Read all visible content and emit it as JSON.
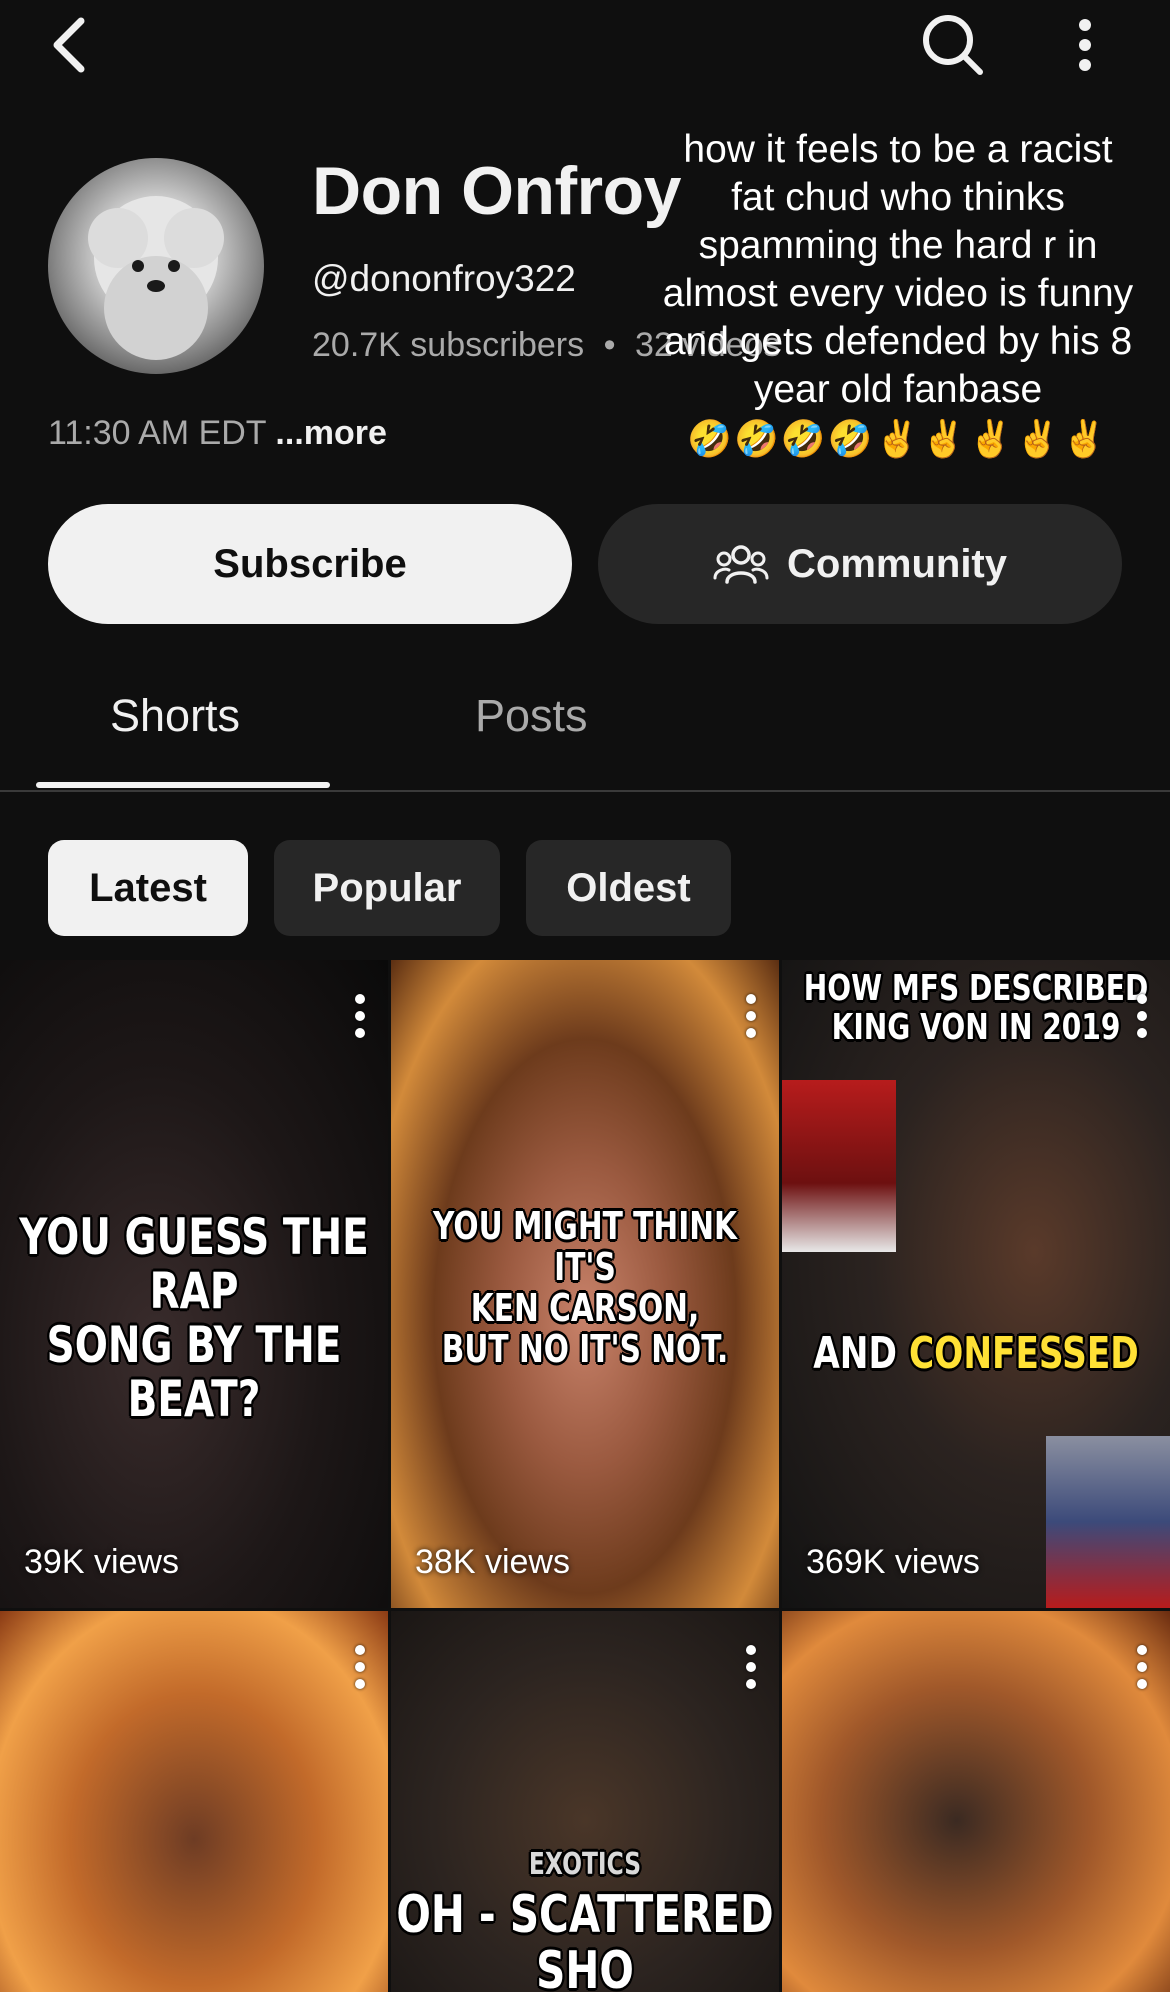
{
  "topbar": {
    "back_icon": "chevron-left-icon",
    "search_icon": "search-icon",
    "more_icon": "more-vertical-icon"
  },
  "channel": {
    "name": "Don Onfroy",
    "handle": "@dononfroy322",
    "subscribers": "20.7K subscribers",
    "separator": "•",
    "videos": "32 videos",
    "time": "11:30 AM EDT ",
    "more_label": "...more"
  },
  "overlay": {
    "caption": "how it feels to be a racist fat chud who thinks spamming the hard r in almost every video is funny and gets defended by his 8 year old fanbase",
    "emoji": "🤣🤣🤣🤣✌️✌️✌️✌️✌️"
  },
  "actions": {
    "subscribe_label": "Subscribe",
    "community_label": "Community",
    "community_icon": "community-icon"
  },
  "tabs": [
    {
      "label": "Shorts",
      "selected": true
    },
    {
      "label": "Posts",
      "selected": false
    }
  ],
  "chips": [
    {
      "label": "Latest",
      "selected": true
    },
    {
      "label": "Popular",
      "selected": false
    },
    {
      "label": "Oldest",
      "selected": false
    }
  ],
  "shorts": [
    {
      "caption_lines": [
        "YOU GUESS THE RAP",
        "SONG BY THE BEAT?"
      ],
      "views": "39K views"
    },
    {
      "caption_lines": [
        "YOU MIGHT THINK IT'S",
        "KEN CARSON,",
        "BUT NO IT'S NOT."
      ],
      "views": "38K views"
    },
    {
      "caption_top_lines": [
        "HOW MFS DESCRIBED",
        "KING VON IN 2019"
      ],
      "caption_mid_plain": "AND ",
      "caption_mid_highlight": "CONFESSED",
      "views": "369K views"
    },
    {
      "views": ""
    },
    {
      "caption_lines": [
        "EXOTICS",
        "OH - SCATTERED SHO"
      ],
      "views": ""
    },
    {
      "views": ""
    }
  ],
  "colors": {
    "background": "#0f0f0f",
    "chip_selected": "#f1f1f1",
    "chip_unselected": "#272727",
    "secondary_text": "#aaaaaa",
    "caption_highlight": "#ffe135"
  }
}
